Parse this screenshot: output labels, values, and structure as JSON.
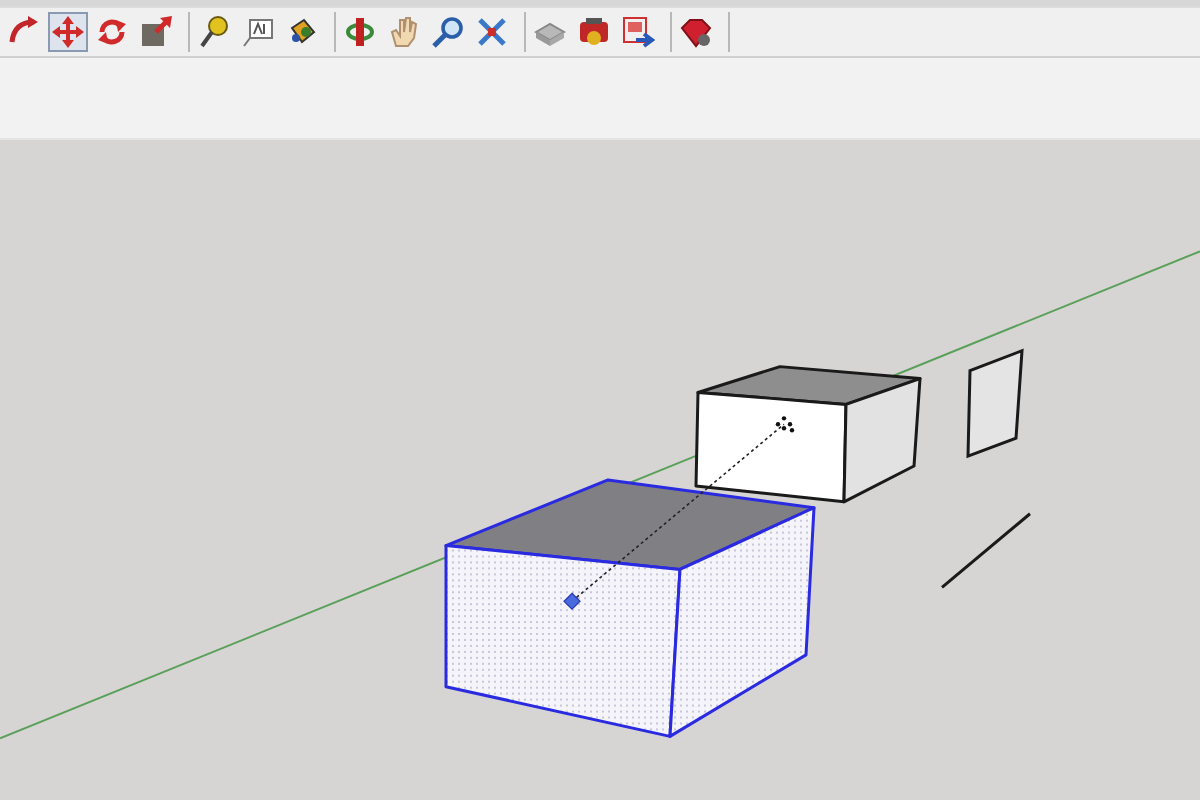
{
  "toolbar": {
    "groups": [
      {
        "buttons": [
          {
            "kind": "followme",
            "selected": false
          },
          {
            "kind": "move",
            "selected": true
          },
          {
            "kind": "rotate",
            "selected": false
          },
          {
            "kind": "scale",
            "selected": false
          }
        ]
      },
      {
        "buttons": [
          {
            "kind": "tape",
            "selected": false
          },
          {
            "kind": "text",
            "selected": false
          },
          {
            "kind": "paint",
            "selected": false
          }
        ]
      },
      {
        "buttons": [
          {
            "kind": "orbit",
            "selected": false
          },
          {
            "kind": "pan",
            "selected": false
          },
          {
            "kind": "zoom",
            "selected": false
          },
          {
            "kind": "extents",
            "selected": false
          }
        ]
      },
      {
        "buttons": [
          {
            "kind": "component",
            "selected": false
          },
          {
            "kind": "materials",
            "selected": false
          },
          {
            "kind": "share",
            "selected": false
          }
        ]
      },
      {
        "buttons": [
          {
            "kind": "ruby",
            "selected": false
          }
        ]
      }
    ]
  },
  "scene": {
    "selected_box": {
      "selected": true
    }
  }
}
